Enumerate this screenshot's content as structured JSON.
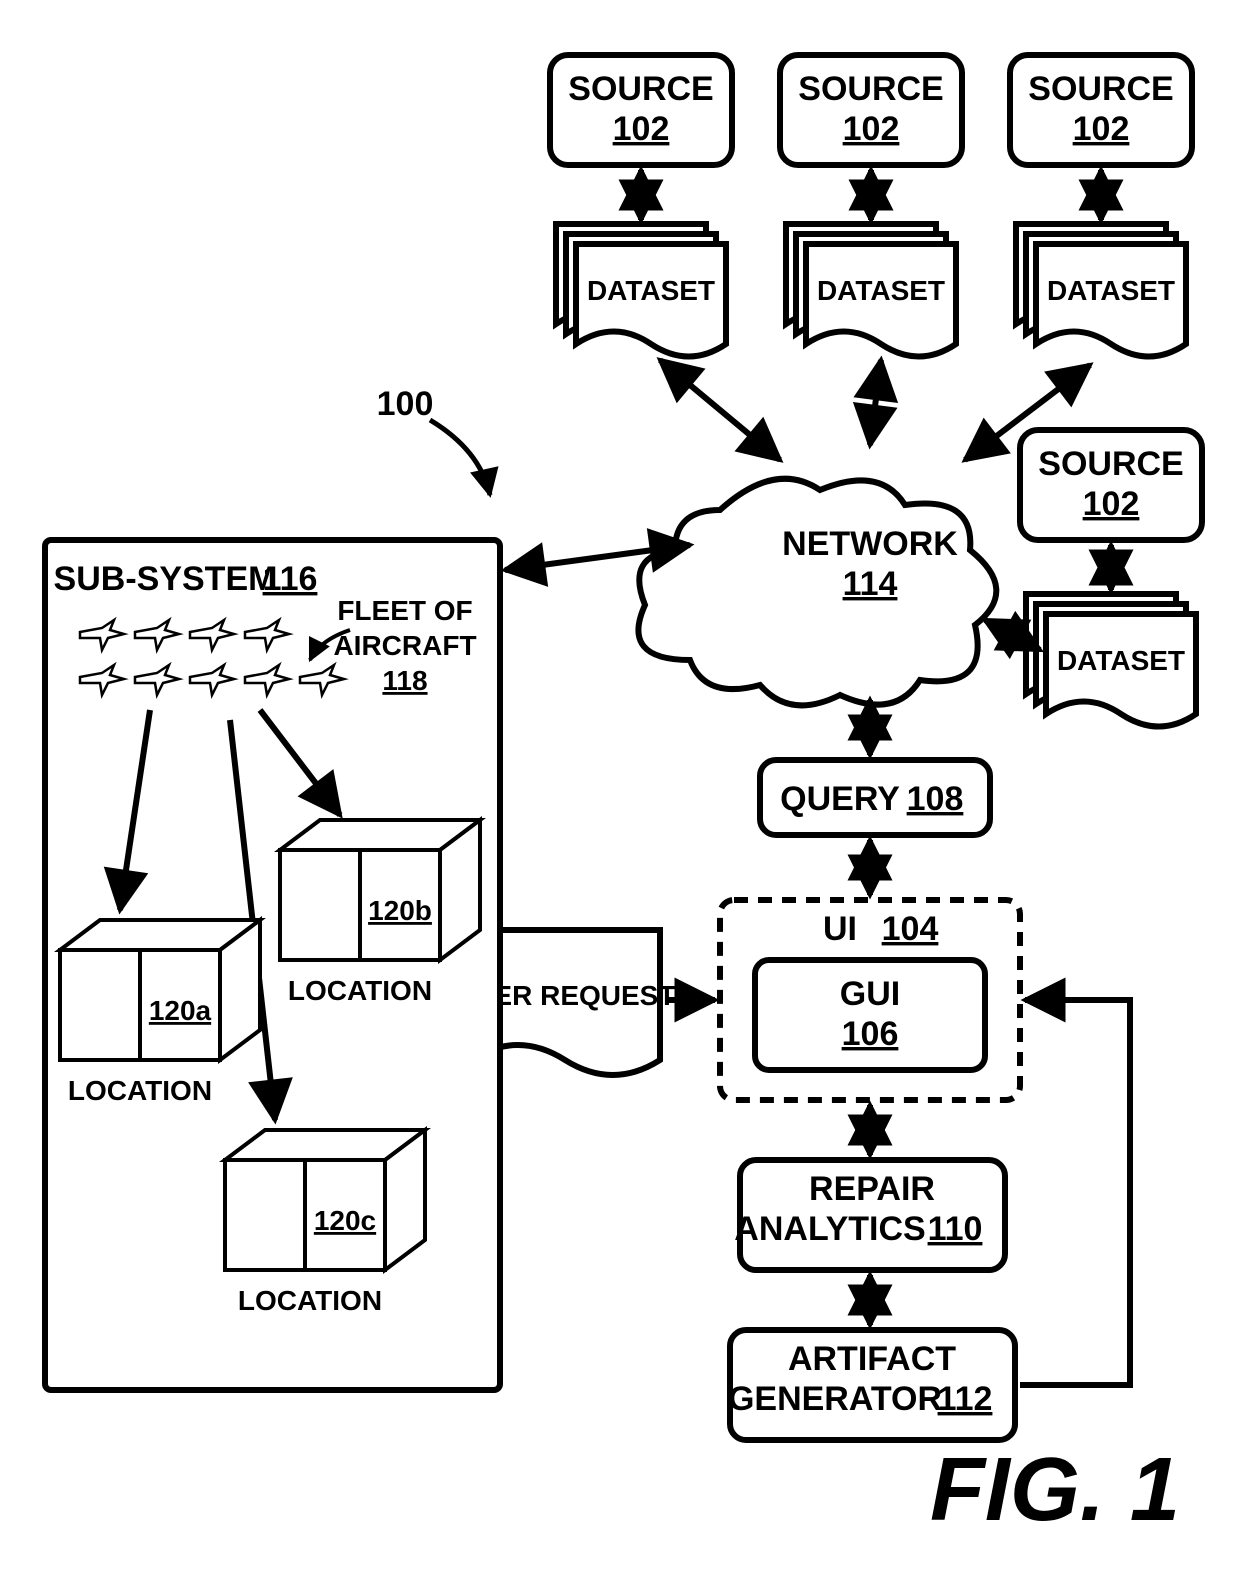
{
  "figure": {
    "ref_num": "100",
    "label": "FIG. 1"
  },
  "sources": [
    {
      "label": "SOURCE",
      "ref": "102"
    },
    {
      "label": "SOURCE",
      "ref": "102"
    },
    {
      "label": "SOURCE",
      "ref": "102"
    },
    {
      "label": "SOURCE",
      "ref": "102"
    }
  ],
  "datasets": [
    {
      "label": "DATASET"
    },
    {
      "label": "DATASET"
    },
    {
      "label": "DATASET"
    },
    {
      "label": "DATASET"
    }
  ],
  "network": {
    "label": "NETWORK",
    "ref": "114"
  },
  "query": {
    "label": "QUERY",
    "ref": "108"
  },
  "ui": {
    "label": "UI",
    "ref": "104"
  },
  "gui": {
    "label": "GUI",
    "ref": "106"
  },
  "repair_analytics": {
    "label1": "REPAIR",
    "label2": "ANALYTICS",
    "ref": "110"
  },
  "artifact_generator": {
    "label1": "ARTIFACT",
    "label2": "GENERATOR",
    "ref": "112"
  },
  "user_request": {
    "label": "USER REQUEST"
  },
  "subsystem": {
    "label": "SUB-SYSTEM",
    "ref": "116"
  },
  "fleet": {
    "label1": "FLEET OF",
    "label2": "AIRCRAFT",
    "ref": "118"
  },
  "locations": [
    {
      "label": "LOCATION",
      "ref": "120a"
    },
    {
      "label": "LOCATION",
      "ref": "120b"
    },
    {
      "label": "LOCATION",
      "ref": "120c"
    }
  ]
}
